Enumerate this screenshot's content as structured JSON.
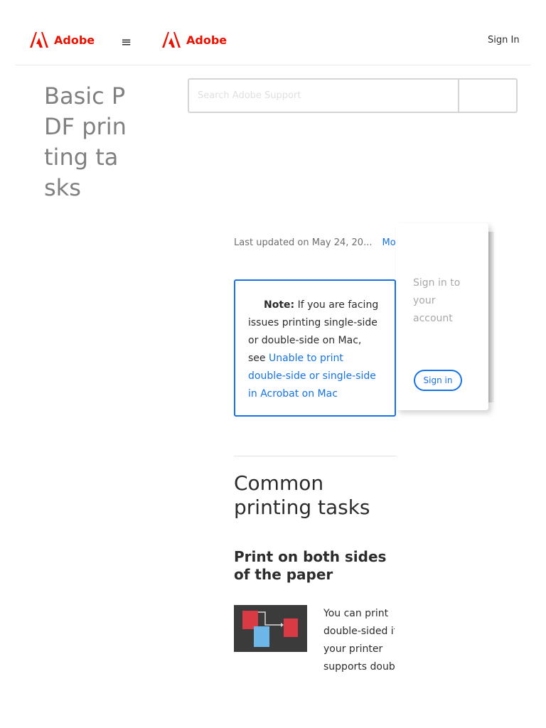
{
  "header": {
    "logo_primary": "Adobe",
    "menu_icon": "hamburger-icon",
    "logo_secondary": "Adobe",
    "sign_in_label": "Sign In",
    "brand_color": "#eb1000"
  },
  "page": {
    "title": "Basic PDF printing tasks"
  },
  "search": {
    "placeholder": "Search Adobe Support"
  },
  "article": {
    "updated_text": "Last updated on May 24, 20...",
    "more_label": "More",
    "note": {
      "label": "Note:",
      "text_before": " If you are facing issues printing single-side or double-side on Mac, see ",
      "link_text": "Unable to print double-side or single-side in Acrobat on Mac"
    },
    "section_title": "Common printing tasks",
    "subsection_title": "Print on both sides of the paper",
    "thumbnail_icon": "duplex-print-icon",
    "paragraph_lines": [
      "You can print",
      "double-sided if",
      "your printer",
      "supports doubl"
    ]
  },
  "signin_card": {
    "prompt": "Sign in to your account",
    "button_label": "Sign in",
    "accent_color": "#1473e6"
  }
}
